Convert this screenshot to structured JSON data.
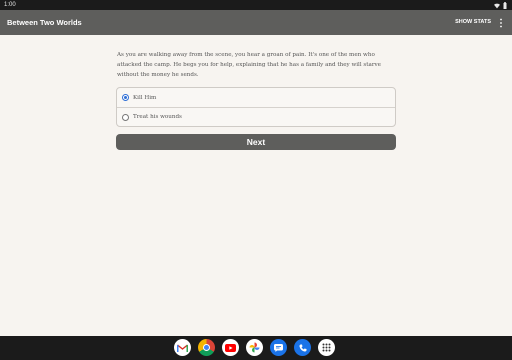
{
  "status_bar": {
    "time": "1:00"
  },
  "app_bar": {
    "title": "Between Two Worlds",
    "show_stats_label": "SHOW STATS"
  },
  "story": {
    "text": "As you are walking away from the scene, you hear a groan of pain. It's one of the men who attacked the camp. He begs you for help, explaining that he has a family and they will starve without the money he sends.",
    "choices": [
      {
        "label": "Kill Him",
        "selected": true
      },
      {
        "label": "Treat his wounds",
        "selected": false
      }
    ],
    "next_label": "Next"
  },
  "taskbar": {
    "apps": [
      "gmail-icon",
      "chrome-icon",
      "youtube-icon",
      "photos-icon",
      "messages-icon",
      "phone-icon",
      "app-drawer-icon"
    ]
  },
  "colors": {
    "app_bar": "#5e5e5c",
    "background": "#f7f4f0",
    "radio_accent": "#2f6fd6"
  }
}
